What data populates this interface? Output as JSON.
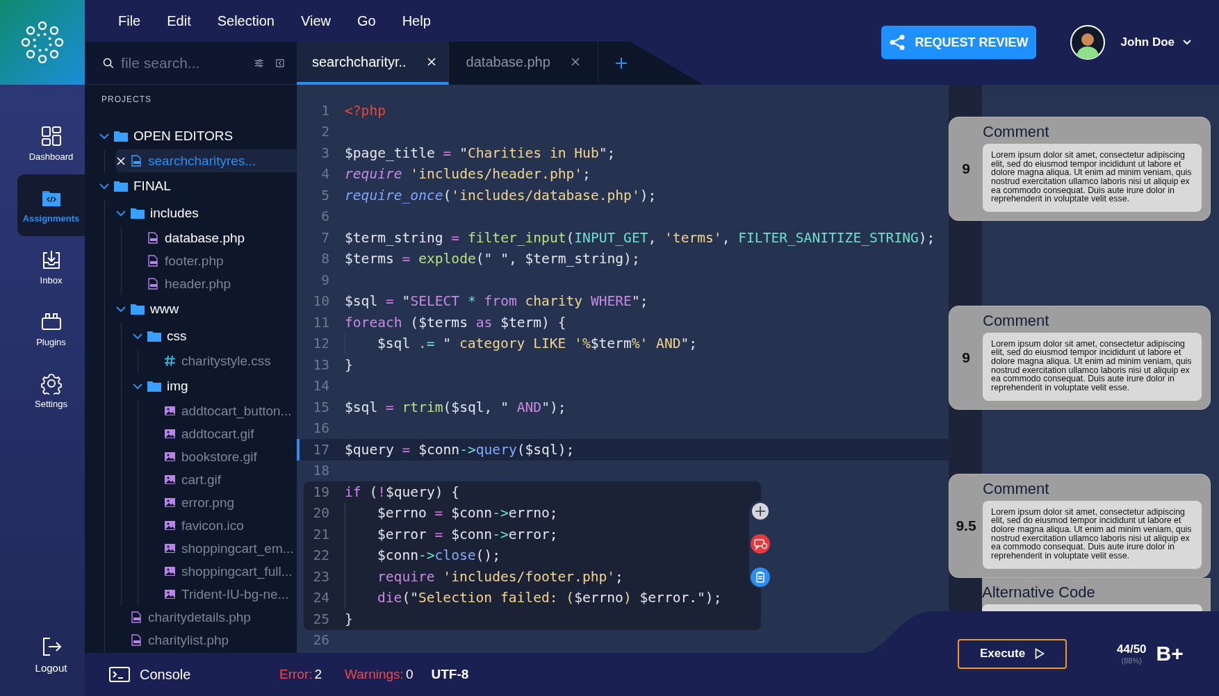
{
  "menu": [
    {
      "label": "File"
    },
    {
      "label": "Edit"
    },
    {
      "label": "Selection"
    },
    {
      "label": "View"
    },
    {
      "label": "Go"
    },
    {
      "label": "Help"
    }
  ],
  "nav": [
    {
      "kind": "dashboard",
      "label": "Dashboard",
      "selected": false
    },
    {
      "kind": "assignments",
      "label": "Assignments",
      "selected": true
    },
    {
      "kind": "inbox",
      "label": "Inbox",
      "selected": false
    },
    {
      "kind": "plugins",
      "label": "Plugins",
      "selected": false
    },
    {
      "kind": "settings",
      "label": "Settings",
      "selected": false
    }
  ],
  "logout": {
    "label": "Logout"
  },
  "search": {
    "placeholder": "file search..."
  },
  "tabs": [
    {
      "label": "searchcharityr..",
      "selected": true
    },
    {
      "label": "database.php",
      "selected": false
    }
  ],
  "header": {
    "review_button": "REQUEST REVIEW",
    "user": "John Doe"
  },
  "tree": {
    "label": "PROJECTS",
    "items": [
      {
        "kind": "folder",
        "label": "OPEN EDITORS",
        "expanded": true,
        "selected": false,
        "children": [
          {
            "kind": "editor",
            "label": "searchcharityres...",
            "selected": true,
            "open": true
          }
        ]
      },
      {
        "kind": "folder",
        "label": "FINAL",
        "expanded": true,
        "selected": false,
        "children": [
          {
            "kind": "folder",
            "label": "includes",
            "expanded": true,
            "selected": false,
            "children": [
              {
                "kind": "php",
                "label": "database.php",
                "selected": false,
                "open": true
              },
              {
                "kind": "php",
                "label": "footer.php",
                "selected": false,
                "open": false
              },
              {
                "kind": "php",
                "label": "header.php",
                "selected": false,
                "open": false
              }
            ]
          },
          {
            "kind": "folder",
            "label": "www",
            "expanded": true,
            "selected": false,
            "children": [
              {
                "kind": "folder",
                "label": "css",
                "expanded": true,
                "selected": false,
                "children": [
                  {
                    "kind": "css",
                    "label": "charitystyle.css",
                    "selected": false,
                    "open": false
                  }
                ]
              },
              {
                "kind": "folder",
                "label": "img",
                "expanded": true,
                "selected": false,
                "children": [
                  {
                    "kind": "image",
                    "label": "addtocart_button...",
                    "selected": false,
                    "open": false
                  },
                  {
                    "kind": "image",
                    "label": "addtocart.gif",
                    "selected": false,
                    "open": false
                  },
                  {
                    "kind": "image",
                    "label": "bookstore.gif",
                    "selected": false,
                    "open": false
                  },
                  {
                    "kind": "image",
                    "label": "cart.gif",
                    "selected": false,
                    "open": false
                  },
                  {
                    "kind": "image",
                    "label": "error.png",
                    "selected": false,
                    "open": false
                  },
                  {
                    "kind": "image",
                    "label": "favicon.ico",
                    "selected": false,
                    "open": false
                  },
                  {
                    "kind": "image",
                    "label": "shoppingcart_em...",
                    "selected": false,
                    "open": false
                  },
                  {
                    "kind": "image",
                    "label": "shoppingcart_full...",
                    "selected": false,
                    "open": false
                  },
                  {
                    "kind": "image",
                    "label": "Trident-IU-bg-ne...",
                    "selected": false,
                    "open": false
                  }
                ]
              }
            ]
          },
          {
            "kind": "php",
            "label": "charitydetails.php",
            "selected": false,
            "open": false
          },
          {
            "kind": "php",
            "label": "charitylist.php",
            "selected": false,
            "open": false
          }
        ]
      }
    ]
  },
  "code": {
    "lines": [
      {
        "number": "1",
        "highlighted": false,
        "in_block": false,
        "indented": false,
        "tokens": [
          {
            "kind": "tag",
            "text": "<?php"
          }
        ]
      },
      {
        "number": "2",
        "highlighted": false,
        "in_block": false,
        "indented": false
      },
      {
        "number": "3",
        "highlighted": false,
        "in_block": false,
        "indented": false,
        "tokens": [
          {
            "kind": "plain",
            "text": "$page_title "
          },
          {
            "kind": "op",
            "text": "="
          },
          {
            "kind": "plain",
            "text": " \""
          },
          {
            "kind": "str",
            "text": "Charities in Hub"
          },
          {
            "kind": "plain",
            "text": "\";"
          }
        ]
      },
      {
        "number": "4",
        "highlighted": false,
        "in_block": false,
        "indented": false,
        "tokens": [
          {
            "kind": "kw",
            "text": "require"
          },
          {
            "kind": "str",
            "text": " 'includes/header.php'"
          },
          {
            "kind": "plain",
            "text": ";"
          }
        ]
      },
      {
        "number": "5",
        "highlighted": false,
        "in_block": false,
        "indented": false,
        "tokens": [
          {
            "kind": "call",
            "text": "require_once"
          },
          {
            "kind": "plain",
            "text": "("
          },
          {
            "kind": "str",
            "text": "'includes/database.php'"
          },
          {
            "kind": "plain",
            "text": ");"
          }
        ]
      },
      {
        "number": "6",
        "highlighted": false,
        "in_block": false,
        "indented": false
      },
      {
        "number": "7",
        "highlighted": false,
        "in_block": false,
        "indented": false,
        "tokens": [
          {
            "kind": "plain",
            "text": "$term_string "
          },
          {
            "kind": "op",
            "text": "="
          },
          {
            "kind": "fn",
            "text": " filter_input"
          },
          {
            "kind": "plain",
            "text": "("
          },
          {
            "kind": "const",
            "text": "INPUT_GET"
          },
          {
            "kind": "plain",
            "text": ", "
          },
          {
            "kind": "str",
            "text": "'terms'"
          },
          {
            "kind": "plain",
            "text": ", "
          },
          {
            "kind": "const",
            "text": "FILTER_SANITIZE_STRING"
          },
          {
            "kind": "plain",
            "text": ");"
          }
        ]
      },
      {
        "number": "8",
        "highlighted": false,
        "in_block": false,
        "indented": false,
        "tokens": [
          {
            "kind": "plain",
            "text": "$terms "
          },
          {
            "kind": "op",
            "text": "="
          },
          {
            "kind": "fn",
            "text": " explode"
          },
          {
            "kind": "plain",
            "text": "(\" \", $term_string);"
          }
        ]
      },
      {
        "number": "9",
        "highlighted": false,
        "in_block": false,
        "indented": false
      },
      {
        "number": "10",
        "highlighted": false,
        "in_block": false,
        "indented": false,
        "tokens": [
          {
            "kind": "plain",
            "text": "$sql "
          },
          {
            "kind": "op",
            "text": "="
          },
          {
            "kind": "plain",
            "text": " \""
          },
          {
            "kind": "kwp",
            "text": "SELECT"
          },
          {
            "kind": "const",
            "text": " * "
          },
          {
            "kind": "kwp",
            "text": "from"
          },
          {
            "kind": "str",
            "text": " charity "
          },
          {
            "kind": "kwp",
            "text": "WHERE"
          },
          {
            "kind": "plain",
            "text": "\";"
          }
        ]
      },
      {
        "number": "11",
        "highlighted": false,
        "in_block": false,
        "indented": false,
        "tokens": [
          {
            "kind": "kwp",
            "text": "foreach"
          },
          {
            "kind": "plain",
            "text": " ($terms "
          },
          {
            "kind": "kwp",
            "text": "as"
          },
          {
            "kind": "plain",
            "text": " $term) {"
          }
        ]
      },
      {
        "number": "12",
        "highlighted": false,
        "in_block": false,
        "indented": true,
        "tokens": [
          {
            "kind": "plain",
            "text": "$sql "
          },
          {
            "kind": "const",
            "text": ".="
          },
          {
            "kind": "plain",
            "text": " \" "
          },
          {
            "kind": "str",
            "text": "category LIKE '%"
          },
          {
            "kind": "plain",
            "text": "$term"
          },
          {
            "kind": "str",
            "text": "%' AND"
          },
          {
            "kind": "plain",
            "text": "\";"
          }
        ]
      },
      {
        "number": "13",
        "highlighted": false,
        "in_block": false,
        "indented": false,
        "tokens": [
          {
            "kind": "plain",
            "text": "}"
          }
        ]
      },
      {
        "number": "14",
        "highlighted": false,
        "in_block": false,
        "indented": false
      },
      {
        "number": "15",
        "highlighted": false,
        "in_block": false,
        "indented": false,
        "tokens": [
          {
            "kind": "plain",
            "text": "$sql "
          },
          {
            "kind": "op",
            "text": "="
          },
          {
            "kind": "fn",
            "text": " rtrim"
          },
          {
            "kind": "plain",
            "text": "($sql, \" "
          },
          {
            "kind": "kwp",
            "text": "AND"
          },
          {
            "kind": "plain",
            "text": "\");"
          }
        ]
      },
      {
        "number": "16",
        "highlighted": false,
        "in_block": false,
        "indented": false
      },
      {
        "number": "17",
        "highlighted": true,
        "in_block": false,
        "indented": false,
        "tokens": [
          {
            "kind": "plain",
            "text": "$query "
          },
          {
            "kind": "op",
            "text": "="
          },
          {
            "kind": "plain",
            "text": " $conn"
          },
          {
            "kind": "const",
            "text": "->"
          },
          {
            "kind": "method",
            "text": "query"
          },
          {
            "kind": "plain",
            "text": "($sql);"
          }
        ]
      },
      {
        "number": "18",
        "highlighted": false,
        "in_block": false,
        "indented": false
      },
      {
        "number": "19",
        "highlighted": false,
        "in_block": true,
        "indented": false,
        "tokens": [
          {
            "kind": "kwp",
            "text": "if"
          },
          {
            "kind": "plain",
            "text": " ("
          },
          {
            "kind": "op",
            "text": "!"
          },
          {
            "kind": "plain",
            "text": "$query) {"
          }
        ]
      },
      {
        "number": "20",
        "highlighted": false,
        "in_block": true,
        "indented": true,
        "tokens": [
          {
            "kind": "plain",
            "text": "$errno "
          },
          {
            "kind": "op",
            "text": "="
          },
          {
            "kind": "plain",
            "text": " $conn"
          },
          {
            "kind": "const",
            "text": "->"
          },
          {
            "kind": "plain",
            "text": "errno;"
          }
        ]
      },
      {
        "number": "21",
        "highlighted": false,
        "in_block": true,
        "indented": true,
        "tokens": [
          {
            "kind": "plain",
            "text": "$error "
          },
          {
            "kind": "op",
            "text": "="
          },
          {
            "kind": "plain",
            "text": " $conn"
          },
          {
            "kind": "const",
            "text": "->"
          },
          {
            "kind": "plain",
            "text": "error;"
          }
        ]
      },
      {
        "number": "22",
        "highlighted": false,
        "in_block": true,
        "indented": true,
        "tokens": [
          {
            "kind": "plain",
            "text": "$conn"
          },
          {
            "kind": "const",
            "text": "->"
          },
          {
            "kind": "method",
            "text": "close"
          },
          {
            "kind": "plain",
            "text": "();"
          }
        ]
      },
      {
        "number": "23",
        "highlighted": false,
        "in_block": true,
        "indented": true,
        "tokens": [
          {
            "kind": "kwp",
            "text": "require"
          },
          {
            "kind": "str",
            "text": " 'includes/footer.php'"
          },
          {
            "kind": "plain",
            "text": ";"
          }
        ]
      },
      {
        "number": "24",
        "highlighted": false,
        "in_block": true,
        "indented": true,
        "tokens": [
          {
            "kind": "kwp",
            "text": "die"
          },
          {
            "kind": "plain",
            "text": "(\""
          },
          {
            "kind": "str",
            "text": "Selection failed: ("
          },
          {
            "kind": "plain",
            "text": "$errno"
          },
          {
            "kind": "str",
            "text": ")"
          },
          {
            "kind": "plain",
            "text": " $error.\");"
          }
        ]
      },
      {
        "number": "25",
        "highlighted": false,
        "in_block": true,
        "indented": false,
        "tokens": [
          {
            "kind": "plain",
            "text": "}"
          }
        ]
      },
      {
        "number": "26",
        "highlighted": false,
        "in_block": false,
        "indented": false
      }
    ],
    "block_actions": [
      {
        "kind": "add"
      },
      {
        "kind": "comment"
      },
      {
        "kind": "clipboard"
      }
    ]
  },
  "comments": [
    {
      "score": "9",
      "title": "Comment",
      "body": "Lorem ipsum dolor sit amet, consectetur adipiscing elit, sed do eiusmod tempor incididunt ut labore et dolore magna aliqua. Ut enim ad minim veniam, quis nostrud exercitation ullamco laboris nisi ut aliquip ex ea commodo consequat. Duis aute irure dolor in reprehenderit in voluptate velit esse."
    },
    {
      "score": "9",
      "title": "Comment",
      "body": "Lorem ipsum dolor sit amet, consectetur adipiscing elit, sed do eiusmod tempor incididunt ut labore et dolore magna aliqua. Ut enim ad minim veniam, quis nostrud exercitation ullamco laboris nisi ut aliquip ex ea commodo consequat. Duis aute irure dolor in reprehenderit in voluptate velit esse."
    },
    {
      "score": "9.5",
      "title": "Comment",
      "body": "Lorem ipsum dolor sit amet, consectetur adipiscing elit, sed do eiusmod tempor incididunt ut labore et dolore magna aliqua. Ut enim ad minim veniam, quis nostrud exercitation ullamco laboris nisi ut aliquip ex ea commodo consequat. Duis aute irure dolor in reprehenderit in voluptate velit esse.",
      "alternative_title": "Alternative Code"
    }
  ],
  "status_bar": {
    "console": "Console",
    "error_label": "Error:",
    "error_count": "2",
    "warning_label": "Warnings:",
    "warning_count": "0",
    "encoding": "UTF-8"
  },
  "result": {
    "execute_button": "Execute",
    "score": "44/50",
    "percent": "(88%)",
    "grade": "B+"
  }
}
